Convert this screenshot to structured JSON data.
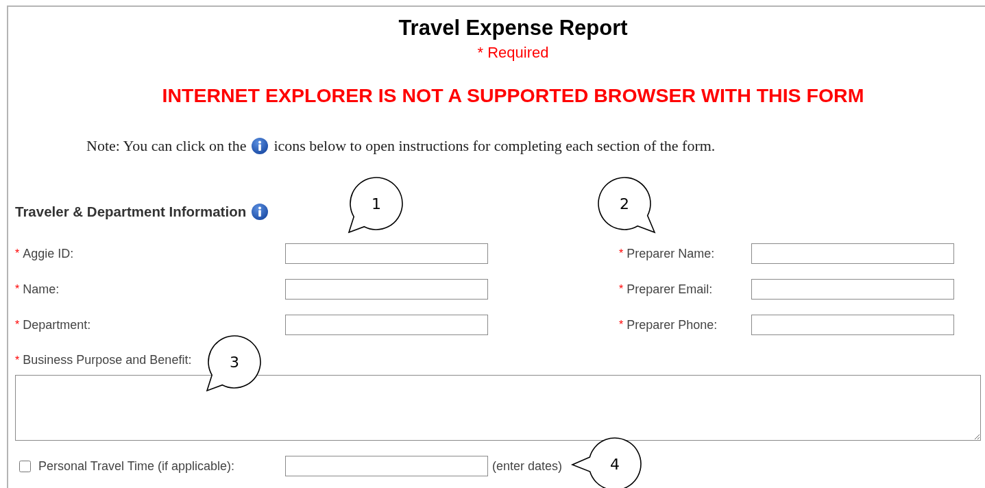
{
  "form": {
    "title": "Travel Expense Report",
    "required_note": "* Required",
    "warning": "INTERNET EXPLORER IS NOT A SUPPORTED BROWSER WITH THIS FORM",
    "note": {
      "before": "Note: You can click on the",
      "after": "icons below to open instructions for completing each section of the form."
    },
    "section": {
      "title": "Traveler & Department Information"
    },
    "left_fields": [
      {
        "mark": "*",
        "label": "Aggie ID:"
      },
      {
        "mark": "*",
        "label": "Name:"
      },
      {
        "mark": "*",
        "label": "Department:"
      }
    ],
    "right_fields": [
      {
        "mark": "*",
        "label": "Preparer Name:"
      },
      {
        "mark": "*",
        "label": "Preparer Email:"
      },
      {
        "mark": "*",
        "label": "Preparer Phone:"
      }
    ],
    "purpose": {
      "mark": "*",
      "label": "Business Purpose and Benefit:"
    },
    "personal_travel": {
      "checked": false,
      "label": "Personal Travel Time (if applicable):",
      "hint": "(enter dates)"
    }
  },
  "callouts": [
    {
      "number": "1"
    },
    {
      "number": "2"
    },
    {
      "number": "3"
    },
    {
      "number": "4"
    }
  ]
}
